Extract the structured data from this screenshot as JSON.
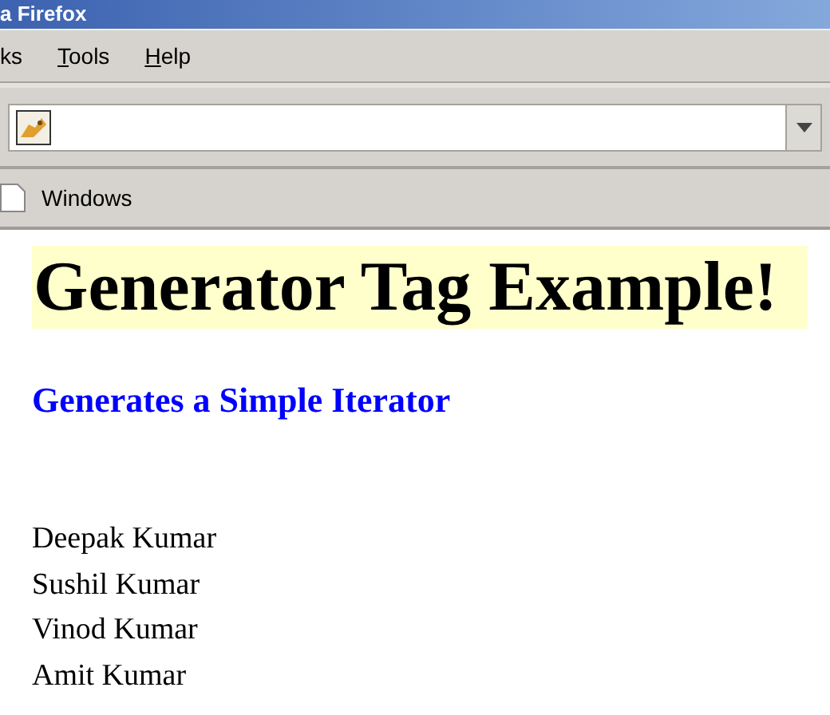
{
  "window": {
    "title": "a Firefox"
  },
  "menu": [
    {
      "label": "ks",
      "underlined": false
    },
    {
      "label": "Tools",
      "underlined": true
    },
    {
      "label": "Help",
      "underlined": true
    }
  ],
  "bookmarks": [
    {
      "label": "Windows"
    }
  ],
  "page": {
    "heading": "Generator Tag Example!",
    "subheading": "Generates a Simple Iterator",
    "names": [
      "Deepak Kumar",
      "Sushil Kumar",
      "Vinod Kumar",
      "Amit Kumar"
    ]
  }
}
